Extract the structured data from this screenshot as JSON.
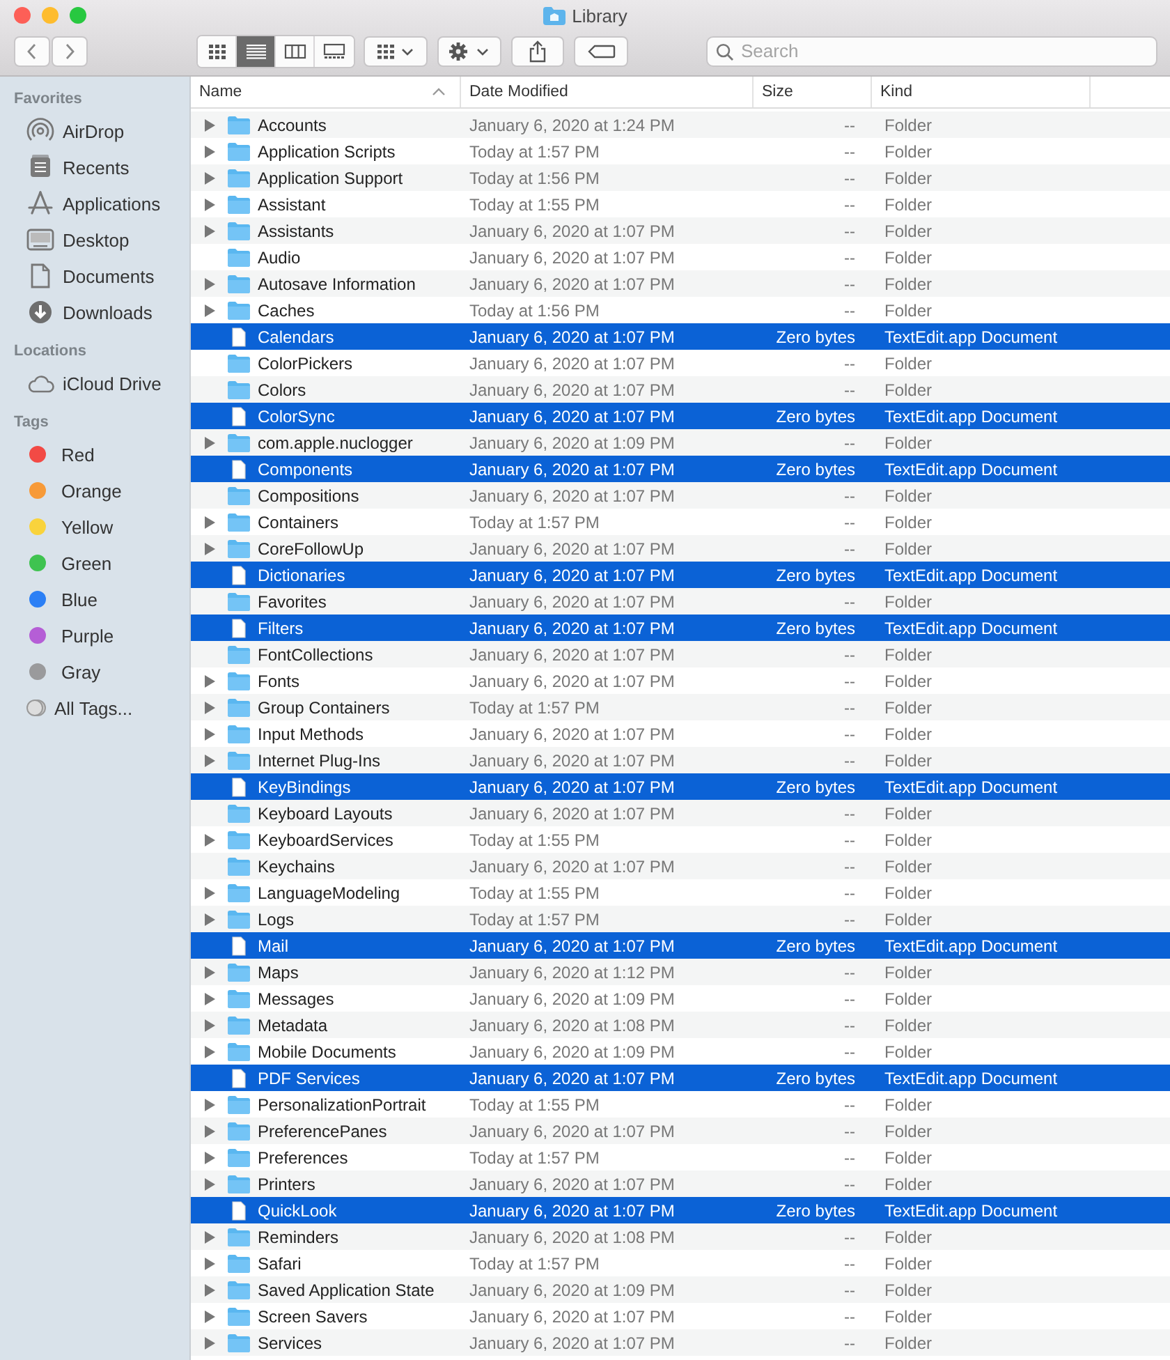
{
  "window": {
    "title": "Library"
  },
  "toolbar": {
    "view_modes": [
      {
        "kind": "icons",
        "selected": false
      },
      {
        "kind": "list",
        "selected": true
      },
      {
        "kind": "columns",
        "selected": false
      },
      {
        "kind": "gallery",
        "selected": false
      }
    ],
    "search": {
      "placeholder": "Search"
    }
  },
  "sidebar": {
    "sections": [
      {
        "title": "Favorites",
        "items": [
          {
            "kind": "airdrop",
            "label": "AirDrop"
          },
          {
            "kind": "recents",
            "label": "Recents"
          },
          {
            "kind": "applications",
            "label": "Applications"
          },
          {
            "kind": "desktop",
            "label": "Desktop"
          },
          {
            "kind": "documents",
            "label": "Documents"
          },
          {
            "kind": "downloads",
            "label": "Downloads"
          }
        ]
      },
      {
        "title": "Locations",
        "items": [
          {
            "kind": "cloud",
            "label": "iCloud Drive"
          }
        ]
      },
      {
        "title": "Tags",
        "items": [
          {
            "kind": "tag",
            "label": "Red",
            "color": "#f24a45"
          },
          {
            "kind": "tag",
            "label": "Orange",
            "color": "#f79a38"
          },
          {
            "kind": "tag",
            "label": "Yellow",
            "color": "#f9d33c"
          },
          {
            "kind": "tag",
            "label": "Green",
            "color": "#3fc350"
          },
          {
            "kind": "tag",
            "label": "Blue",
            "color": "#2b7ff5"
          },
          {
            "kind": "tag",
            "label": "Purple",
            "color": "#b55ed6"
          },
          {
            "kind": "tag",
            "label": "Gray",
            "color": "#9a9a9c"
          },
          {
            "kind": "all-tags",
            "label": "All Tags..."
          }
        ]
      }
    ]
  },
  "table": {
    "columns": [
      {
        "label": "Name",
        "sorted": true
      },
      {
        "label": "Date Modified",
        "sorted": false
      },
      {
        "label": "Size",
        "sorted": false
      },
      {
        "label": "Kind",
        "sorted": false
      }
    ],
    "rows": [
      {
        "name": "Accounts",
        "kind": "folder",
        "expandable": true,
        "selected": false,
        "date": "January 6, 2020 at 1:24 PM",
        "size": "--",
        "type": "Folder"
      },
      {
        "name": "Application Scripts",
        "kind": "folder",
        "expandable": true,
        "selected": false,
        "date": "Today at 1:57 PM",
        "size": "--",
        "type": "Folder"
      },
      {
        "name": "Application Support",
        "kind": "folder",
        "expandable": true,
        "selected": false,
        "date": "Today at 1:56 PM",
        "size": "--",
        "type": "Folder"
      },
      {
        "name": "Assistant",
        "kind": "folder",
        "expandable": true,
        "selected": false,
        "date": "Today at 1:55 PM",
        "size": "--",
        "type": "Folder"
      },
      {
        "name": "Assistants",
        "kind": "folder",
        "expandable": true,
        "selected": false,
        "date": "January 6, 2020 at 1:07 PM",
        "size": "--",
        "type": "Folder"
      },
      {
        "name": "Audio",
        "kind": "folder",
        "expandable": false,
        "selected": false,
        "date": "January 6, 2020 at 1:07 PM",
        "size": "--",
        "type": "Folder"
      },
      {
        "name": "Autosave Information",
        "kind": "folder",
        "expandable": true,
        "selected": false,
        "date": "January 6, 2020 at 1:07 PM",
        "size": "--",
        "type": "Folder"
      },
      {
        "name": "Caches",
        "kind": "folder",
        "expandable": true,
        "selected": false,
        "date": "Today at 1:56 PM",
        "size": "--",
        "type": "Folder"
      },
      {
        "name": "Calendars",
        "kind": "file",
        "expandable": false,
        "selected": true,
        "date": "January 6, 2020 at 1:07 PM",
        "size": "Zero bytes",
        "type": "TextEdit.app Document"
      },
      {
        "name": "ColorPickers",
        "kind": "folder",
        "expandable": false,
        "selected": false,
        "date": "January 6, 2020 at 1:07 PM",
        "size": "--",
        "type": "Folder"
      },
      {
        "name": "Colors",
        "kind": "folder",
        "expandable": false,
        "selected": false,
        "date": "January 6, 2020 at 1:07 PM",
        "size": "--",
        "type": "Folder"
      },
      {
        "name": "ColorSync",
        "kind": "file",
        "expandable": false,
        "selected": true,
        "date": "January 6, 2020 at 1:07 PM",
        "size": "Zero bytes",
        "type": "TextEdit.app Document"
      },
      {
        "name": "com.apple.nuclogger",
        "kind": "folder",
        "expandable": true,
        "selected": false,
        "date": "January 6, 2020 at 1:09 PM",
        "size": "--",
        "type": "Folder"
      },
      {
        "name": "Components",
        "kind": "file",
        "expandable": false,
        "selected": true,
        "date": "January 6, 2020 at 1:07 PM",
        "size": "Zero bytes",
        "type": "TextEdit.app Document"
      },
      {
        "name": "Compositions",
        "kind": "folder",
        "expandable": false,
        "selected": false,
        "date": "January 6, 2020 at 1:07 PM",
        "size": "--",
        "type": "Folder"
      },
      {
        "name": "Containers",
        "kind": "folder",
        "expandable": true,
        "selected": false,
        "date": "Today at 1:57 PM",
        "size": "--",
        "type": "Folder"
      },
      {
        "name": "CoreFollowUp",
        "kind": "folder",
        "expandable": true,
        "selected": false,
        "date": "January 6, 2020 at 1:07 PM",
        "size": "--",
        "type": "Folder"
      },
      {
        "name": "Dictionaries",
        "kind": "file",
        "expandable": false,
        "selected": true,
        "date": "January 6, 2020 at 1:07 PM",
        "size": "Zero bytes",
        "type": "TextEdit.app Document"
      },
      {
        "name": "Favorites",
        "kind": "folder",
        "expandable": false,
        "selected": false,
        "date": "January 6, 2020 at 1:07 PM",
        "size": "--",
        "type": "Folder"
      },
      {
        "name": "Filters",
        "kind": "file",
        "expandable": false,
        "selected": true,
        "date": "January 6, 2020 at 1:07 PM",
        "size": "Zero bytes",
        "type": "TextEdit.app Document"
      },
      {
        "name": "FontCollections",
        "kind": "folder",
        "expandable": false,
        "selected": false,
        "date": "January 6, 2020 at 1:07 PM",
        "size": "--",
        "type": "Folder"
      },
      {
        "name": "Fonts",
        "kind": "folder",
        "expandable": true,
        "selected": false,
        "date": "January 6, 2020 at 1:07 PM",
        "size": "--",
        "type": "Folder"
      },
      {
        "name": "Group Containers",
        "kind": "folder",
        "expandable": true,
        "selected": false,
        "date": "Today at 1:57 PM",
        "size": "--",
        "type": "Folder"
      },
      {
        "name": "Input Methods",
        "kind": "folder",
        "expandable": true,
        "selected": false,
        "date": "January 6, 2020 at 1:07 PM",
        "size": "--",
        "type": "Folder"
      },
      {
        "name": "Internet Plug-Ins",
        "kind": "folder",
        "expandable": true,
        "selected": false,
        "date": "January 6, 2020 at 1:07 PM",
        "size": "--",
        "type": "Folder"
      },
      {
        "name": "KeyBindings",
        "kind": "file",
        "expandable": false,
        "selected": true,
        "date": "January 6, 2020 at 1:07 PM",
        "size": "Zero bytes",
        "type": "TextEdit.app Document"
      },
      {
        "name": "Keyboard Layouts",
        "kind": "folder",
        "expandable": false,
        "selected": false,
        "date": "January 6, 2020 at 1:07 PM",
        "size": "--",
        "type": "Folder"
      },
      {
        "name": "KeyboardServices",
        "kind": "folder",
        "expandable": true,
        "selected": false,
        "date": "Today at 1:55 PM",
        "size": "--",
        "type": "Folder"
      },
      {
        "name": "Keychains",
        "kind": "folder",
        "expandable": false,
        "selected": false,
        "date": "January 6, 2020 at 1:07 PM",
        "size": "--",
        "type": "Folder"
      },
      {
        "name": "LanguageModeling",
        "kind": "folder",
        "expandable": true,
        "selected": false,
        "date": "Today at 1:55 PM",
        "size": "--",
        "type": "Folder"
      },
      {
        "name": "Logs",
        "kind": "folder",
        "expandable": true,
        "selected": false,
        "date": "Today at 1:57 PM",
        "size": "--",
        "type": "Folder"
      },
      {
        "name": "Mail",
        "kind": "file",
        "expandable": false,
        "selected": true,
        "date": "January 6, 2020 at 1:07 PM",
        "size": "Zero bytes",
        "type": "TextEdit.app Document"
      },
      {
        "name": "Maps",
        "kind": "folder",
        "expandable": true,
        "selected": false,
        "date": "January 6, 2020 at 1:12 PM",
        "size": "--",
        "type": "Folder"
      },
      {
        "name": "Messages",
        "kind": "folder",
        "expandable": true,
        "selected": false,
        "date": "January 6, 2020 at 1:09 PM",
        "size": "--",
        "type": "Folder"
      },
      {
        "name": "Metadata",
        "kind": "folder",
        "expandable": true,
        "selected": false,
        "date": "January 6, 2020 at 1:08 PM",
        "size": "--",
        "type": "Folder"
      },
      {
        "name": "Mobile Documents",
        "kind": "folder",
        "expandable": true,
        "selected": false,
        "date": "January 6, 2020 at 1:09 PM",
        "size": "--",
        "type": "Folder"
      },
      {
        "name": "PDF Services",
        "kind": "file",
        "expandable": false,
        "selected": true,
        "date": "January 6, 2020 at 1:07 PM",
        "size": "Zero bytes",
        "type": "TextEdit.app Document"
      },
      {
        "name": "PersonalizationPortrait",
        "kind": "folder",
        "expandable": true,
        "selected": false,
        "date": "Today at 1:55 PM",
        "size": "--",
        "type": "Folder"
      },
      {
        "name": "PreferencePanes",
        "kind": "folder",
        "expandable": true,
        "selected": false,
        "date": "January 6, 2020 at 1:07 PM",
        "size": "--",
        "type": "Folder"
      },
      {
        "name": "Preferences",
        "kind": "folder",
        "expandable": true,
        "selected": false,
        "date": "Today at 1:57 PM",
        "size": "--",
        "type": "Folder"
      },
      {
        "name": "Printers",
        "kind": "folder",
        "expandable": true,
        "selected": false,
        "date": "January 6, 2020 at 1:07 PM",
        "size": "--",
        "type": "Folder"
      },
      {
        "name": "QuickLook",
        "kind": "file",
        "expandable": false,
        "selected": true,
        "date": "January 6, 2020 at 1:07 PM",
        "size": "Zero bytes",
        "type": "TextEdit.app Document"
      },
      {
        "name": "Reminders",
        "kind": "folder",
        "expandable": true,
        "selected": false,
        "date": "January 6, 2020 at 1:08 PM",
        "size": "--",
        "type": "Folder"
      },
      {
        "name": "Safari",
        "kind": "folder",
        "expandable": true,
        "selected": false,
        "date": "Today at 1:57 PM",
        "size": "--",
        "type": "Folder"
      },
      {
        "name": "Saved Application State",
        "kind": "folder",
        "expandable": true,
        "selected": false,
        "date": "January 6, 2020 at 1:09 PM",
        "size": "--",
        "type": "Folder"
      },
      {
        "name": "Screen Savers",
        "kind": "folder",
        "expandable": true,
        "selected": false,
        "date": "January 6, 2020 at 1:07 PM",
        "size": "--",
        "type": "Folder"
      },
      {
        "name": "Services",
        "kind": "folder",
        "expandable": true,
        "selected": false,
        "date": "January 6, 2020 at 1:07 PM",
        "size": "--",
        "type": "Folder"
      }
    ]
  }
}
